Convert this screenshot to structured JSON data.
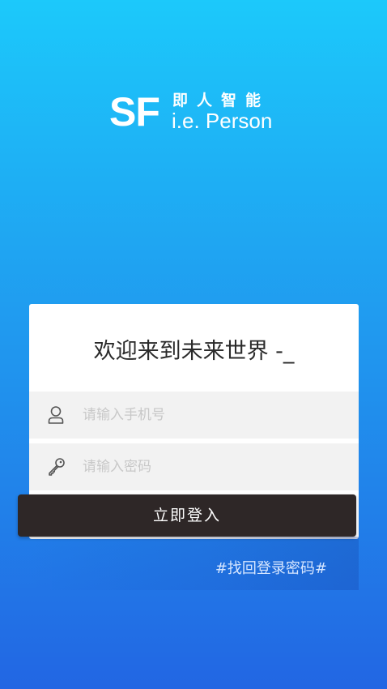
{
  "brand": {
    "logo_letters": "SF",
    "name_cn": "即人智能",
    "name_en": "i.e. Person"
  },
  "login": {
    "welcome": "欢迎来到未来世界 -_",
    "phone_placeholder": "请输入手机号",
    "password_placeholder": "请输入密码",
    "submit_label": "立即登入",
    "forgot_label": "#找回登录密码#"
  },
  "icons": {
    "phone_field": "user-icon",
    "password_field": "key-icon"
  },
  "colors": {
    "background_top": "#1cc9fb",
    "background_bottom": "#2266e3",
    "button": "#2e2727",
    "field_background": "#f2f2f2"
  }
}
